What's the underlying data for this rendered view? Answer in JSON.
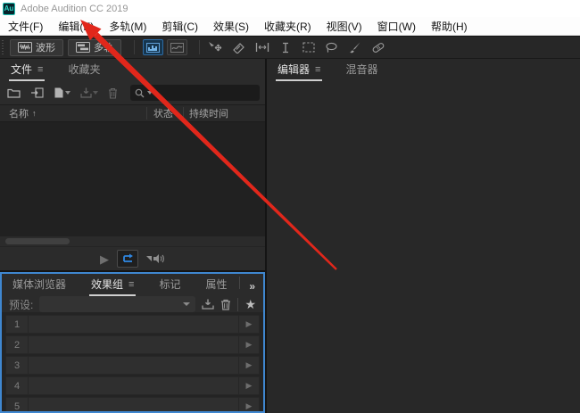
{
  "titlebar": {
    "logo": "Au",
    "title": "Adobe Audition CC 2019"
  },
  "menubar": {
    "items": [
      "文件(F)",
      "编辑(E)",
      "多轨(M)",
      "剪辑(C)",
      "效果(S)",
      "收藏夹(R)",
      "视图(V)",
      "窗口(W)",
      "帮助(H)"
    ]
  },
  "toolbar": {
    "waveform_label": "波形",
    "multitrack_label": "多轨"
  },
  "files_panel": {
    "tab_files": "文件",
    "tab_favorites": "收藏夹",
    "menu_glyph": "≡",
    "search_value": "",
    "columns": {
      "name": "名称",
      "sort_indicator": "↑",
      "status": "状态",
      "duration": "持续时间"
    },
    "rows": []
  },
  "rack_panel": {
    "tab_media_browser": "媒体浏览器",
    "tab_effects_rack": "效果组",
    "tab_markers": "标记",
    "tab_properties": "属性",
    "menu_glyph": "≡",
    "overflow_glyph": "»",
    "preset_label": "预设:",
    "preset_value": "",
    "slots": [
      "1",
      "2",
      "3",
      "4",
      "5"
    ],
    "slot_arrow_glyph": "▶"
  },
  "editor_panel": {
    "tab_editor": "编辑器",
    "tab_mixer": "混音器",
    "menu_glyph": "≡"
  },
  "transport": {
    "play_glyph": "▶"
  },
  "colors": {
    "accent_blue": "#2f86e0",
    "focus_border": "#3f87d0",
    "arrow_red": "#e1271b",
    "logo_teal": "#1cc0b4",
    "titlebar_bg": "#ffffff",
    "panel_bg": "#2b2b2b"
  }
}
